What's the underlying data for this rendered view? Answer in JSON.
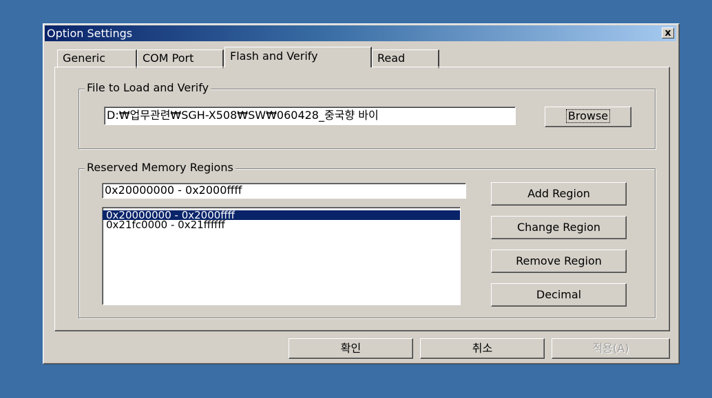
{
  "window": {
    "title": "Option Settings",
    "close_label": "x"
  },
  "tabs": [
    {
      "label": "Generic",
      "active": false
    },
    {
      "label": "COM Port",
      "active": false
    },
    {
      "label": "Flash and Verify",
      "active": true
    },
    {
      "label": "Read",
      "active": false
    }
  ],
  "file_group": {
    "label": "File to Load and Verify",
    "path_value": "D:₩업무관련₩SGH-X508₩SW₩060428_중국향 바이",
    "browse_label": "Browse"
  },
  "memory_group": {
    "label": "Reserved Memory Regions",
    "region_input_value": "0x20000000 - 0x2000ffff",
    "regions": [
      {
        "label": "0x20000000 - 0x2000ffff",
        "selected": true
      },
      {
        "label": "0x21fc0000 - 0x21ffffff",
        "selected": false
      }
    ],
    "add_label": "Add Region",
    "change_label": "Change Region",
    "remove_label": "Remove Region",
    "decimal_label": "Decimal"
  },
  "footer": {
    "ok_label": "확인",
    "cancel_label": "취소",
    "apply_label": "적용(A)"
  },
  "colors": {
    "desktop": "#3a6ea5",
    "face": "#d4d0c8",
    "selection": "#0a246a"
  }
}
